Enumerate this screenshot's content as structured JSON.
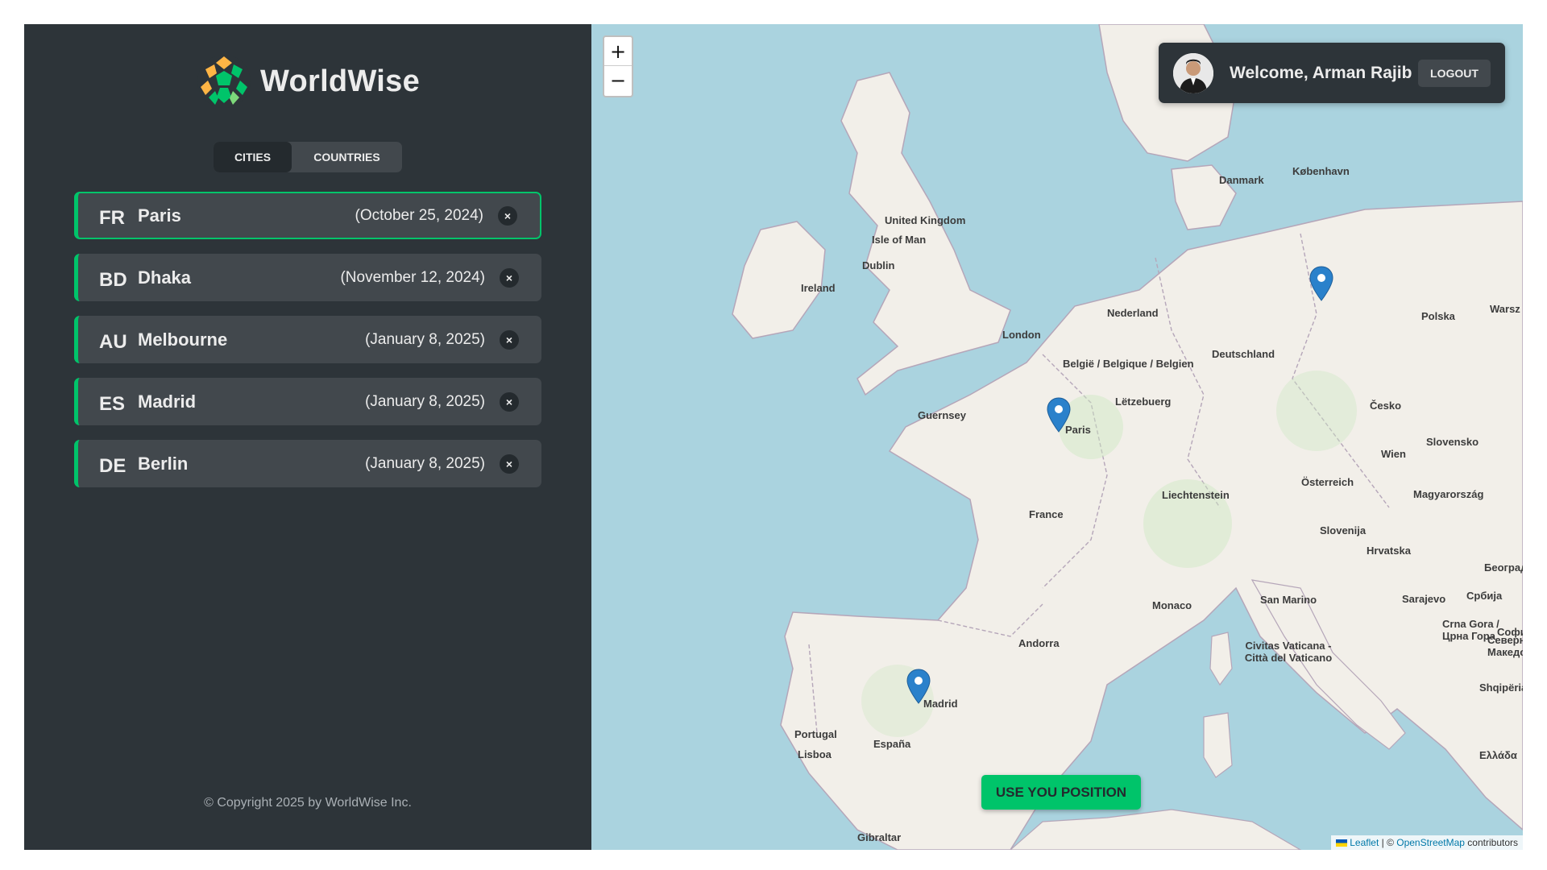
{
  "app": {
    "name": "WorldWise"
  },
  "tabs": {
    "cities": "CITIES",
    "countries": "COUNTRIES"
  },
  "cities": [
    {
      "code": "FR",
      "name": "Paris",
      "date": "(October 25, 2024)",
      "delete": "×"
    },
    {
      "code": "BD",
      "name": "Dhaka",
      "date": "(November 12, 2024)",
      "delete": "×"
    },
    {
      "code": "AU",
      "name": "Melbourne",
      "date": "(January 8, 2025)",
      "delete": "×"
    },
    {
      "code": "ES",
      "name": "Madrid",
      "date": "(January 8, 2025)",
      "delete": "×"
    },
    {
      "code": "DE",
      "name": "Berlin",
      "date": "(January 8, 2025)",
      "delete": "×"
    }
  ],
  "footer": {
    "copyright": "© Copyright 2025 by WorldWise Inc."
  },
  "map": {
    "zoom_in": "+",
    "zoom_out": "−",
    "user": {
      "welcome": "Welcome, Arman Rajib",
      "logout": "LOGOUT"
    },
    "position_button": "USE YOU POSITION",
    "attribution": {
      "leaflet": "Leaflet",
      "sep": " | © ",
      "osm": "OpenStreetMap",
      "contributors": " contributors"
    },
    "labels": {
      "uk": "United Kingdom",
      "iom": "Isle of Man",
      "dublin": "Dublin",
      "ireland": "Ireland",
      "london": "London",
      "danmark": "Danmark",
      "kobenhavn": "København",
      "nederland": "Nederland",
      "belgie": "België / Belgique / Belgien",
      "letzebuerg": "Lëtzebuerg",
      "deutschland": "Deutschland",
      "polska": "Polska",
      "cesko": "Česko",
      "paris": "Paris",
      "guernsey": "Guernsey",
      "france": "France",
      "liechtenstein": "Liechtenstein",
      "osterreich": "Österreich",
      "wien": "Wien",
      "slovensko": "Slovensko",
      "magyar": "Magyarország",
      "slovenija": "Slovenija",
      "hrvatska": "Hrvatska",
      "monaco": "Monaco",
      "sanmarino": "San Marino",
      "andorra": "Andorra",
      "vatican": "Civitas Vaticana - Città del Vaticano",
      "madrid": "Madrid",
      "portugal": "Portugal",
      "lisboa": "Lisboa",
      "espana": "España",
      "gibraltar": "Gibraltar",
      "sarajevo": "Sarajevo",
      "crnagora": "Crna Gora / Црна Гора",
      "shqiperia": "Shqipëria",
      "beograd": "Београд",
      "srbija": "Србија",
      "ellada": "Ελλάδα",
      "warsz": "Warsz",
      "makedonija": "Северна Македони",
      "sofia": "Софи"
    }
  }
}
